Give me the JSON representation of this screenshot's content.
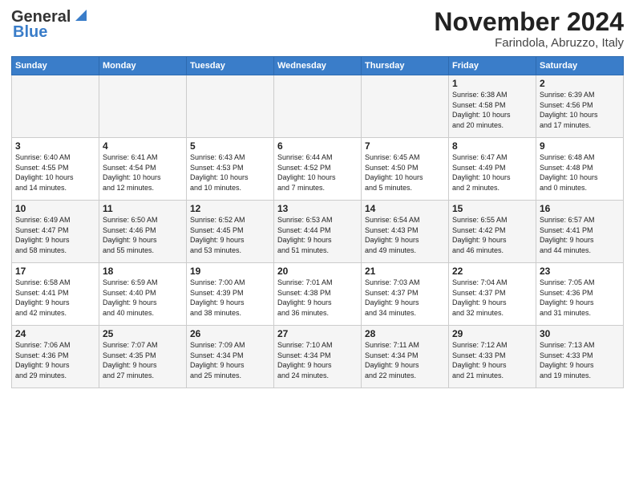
{
  "header": {
    "logo_general": "General",
    "logo_blue": "Blue",
    "month": "November 2024",
    "location": "Farindola, Abruzzo, Italy"
  },
  "days_of_week": [
    "Sunday",
    "Monday",
    "Tuesday",
    "Wednesday",
    "Thursday",
    "Friday",
    "Saturday"
  ],
  "weeks": [
    [
      {
        "day": "",
        "info": ""
      },
      {
        "day": "",
        "info": ""
      },
      {
        "day": "",
        "info": ""
      },
      {
        "day": "",
        "info": ""
      },
      {
        "day": "",
        "info": ""
      },
      {
        "day": "1",
        "info": "Sunrise: 6:38 AM\nSunset: 4:58 PM\nDaylight: 10 hours\nand 20 minutes."
      },
      {
        "day": "2",
        "info": "Sunrise: 6:39 AM\nSunset: 4:56 PM\nDaylight: 10 hours\nand 17 minutes."
      }
    ],
    [
      {
        "day": "3",
        "info": "Sunrise: 6:40 AM\nSunset: 4:55 PM\nDaylight: 10 hours\nand 14 minutes."
      },
      {
        "day": "4",
        "info": "Sunrise: 6:41 AM\nSunset: 4:54 PM\nDaylight: 10 hours\nand 12 minutes."
      },
      {
        "day": "5",
        "info": "Sunrise: 6:43 AM\nSunset: 4:53 PM\nDaylight: 10 hours\nand 10 minutes."
      },
      {
        "day": "6",
        "info": "Sunrise: 6:44 AM\nSunset: 4:52 PM\nDaylight: 10 hours\nand 7 minutes."
      },
      {
        "day": "7",
        "info": "Sunrise: 6:45 AM\nSunset: 4:50 PM\nDaylight: 10 hours\nand 5 minutes."
      },
      {
        "day": "8",
        "info": "Sunrise: 6:47 AM\nSunset: 4:49 PM\nDaylight: 10 hours\nand 2 minutes."
      },
      {
        "day": "9",
        "info": "Sunrise: 6:48 AM\nSunset: 4:48 PM\nDaylight: 10 hours\nand 0 minutes."
      }
    ],
    [
      {
        "day": "10",
        "info": "Sunrise: 6:49 AM\nSunset: 4:47 PM\nDaylight: 9 hours\nand 58 minutes."
      },
      {
        "day": "11",
        "info": "Sunrise: 6:50 AM\nSunset: 4:46 PM\nDaylight: 9 hours\nand 55 minutes."
      },
      {
        "day": "12",
        "info": "Sunrise: 6:52 AM\nSunset: 4:45 PM\nDaylight: 9 hours\nand 53 minutes."
      },
      {
        "day": "13",
        "info": "Sunrise: 6:53 AM\nSunset: 4:44 PM\nDaylight: 9 hours\nand 51 minutes."
      },
      {
        "day": "14",
        "info": "Sunrise: 6:54 AM\nSunset: 4:43 PM\nDaylight: 9 hours\nand 49 minutes."
      },
      {
        "day": "15",
        "info": "Sunrise: 6:55 AM\nSunset: 4:42 PM\nDaylight: 9 hours\nand 46 minutes."
      },
      {
        "day": "16",
        "info": "Sunrise: 6:57 AM\nSunset: 4:41 PM\nDaylight: 9 hours\nand 44 minutes."
      }
    ],
    [
      {
        "day": "17",
        "info": "Sunrise: 6:58 AM\nSunset: 4:41 PM\nDaylight: 9 hours\nand 42 minutes."
      },
      {
        "day": "18",
        "info": "Sunrise: 6:59 AM\nSunset: 4:40 PM\nDaylight: 9 hours\nand 40 minutes."
      },
      {
        "day": "19",
        "info": "Sunrise: 7:00 AM\nSunset: 4:39 PM\nDaylight: 9 hours\nand 38 minutes."
      },
      {
        "day": "20",
        "info": "Sunrise: 7:01 AM\nSunset: 4:38 PM\nDaylight: 9 hours\nand 36 minutes."
      },
      {
        "day": "21",
        "info": "Sunrise: 7:03 AM\nSunset: 4:37 PM\nDaylight: 9 hours\nand 34 minutes."
      },
      {
        "day": "22",
        "info": "Sunrise: 7:04 AM\nSunset: 4:37 PM\nDaylight: 9 hours\nand 32 minutes."
      },
      {
        "day": "23",
        "info": "Sunrise: 7:05 AM\nSunset: 4:36 PM\nDaylight: 9 hours\nand 31 minutes."
      }
    ],
    [
      {
        "day": "24",
        "info": "Sunrise: 7:06 AM\nSunset: 4:36 PM\nDaylight: 9 hours\nand 29 minutes."
      },
      {
        "day": "25",
        "info": "Sunrise: 7:07 AM\nSunset: 4:35 PM\nDaylight: 9 hours\nand 27 minutes."
      },
      {
        "day": "26",
        "info": "Sunrise: 7:09 AM\nSunset: 4:34 PM\nDaylight: 9 hours\nand 25 minutes."
      },
      {
        "day": "27",
        "info": "Sunrise: 7:10 AM\nSunset: 4:34 PM\nDaylight: 9 hours\nand 24 minutes."
      },
      {
        "day": "28",
        "info": "Sunrise: 7:11 AM\nSunset: 4:34 PM\nDaylight: 9 hours\nand 22 minutes."
      },
      {
        "day": "29",
        "info": "Sunrise: 7:12 AM\nSunset: 4:33 PM\nDaylight: 9 hours\nand 21 minutes."
      },
      {
        "day": "30",
        "info": "Sunrise: 7:13 AM\nSunset: 4:33 PM\nDaylight: 9 hours\nand 19 minutes."
      }
    ]
  ]
}
